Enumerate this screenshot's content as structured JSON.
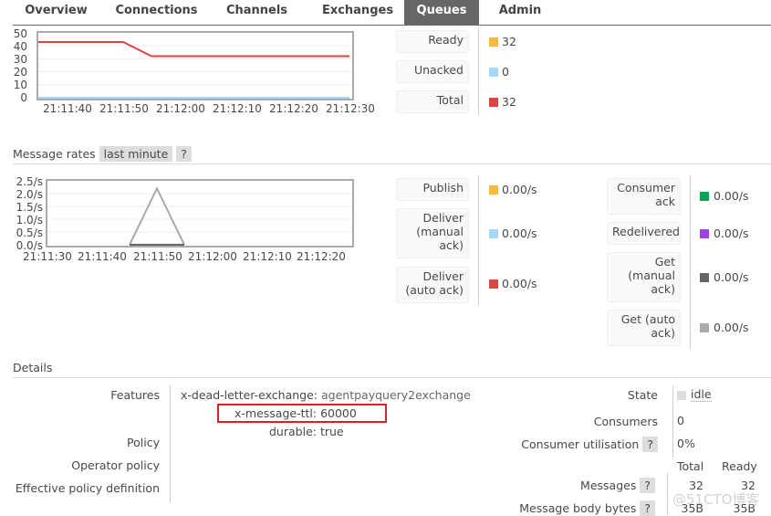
{
  "tabs": [
    {
      "label": "Overview"
    },
    {
      "label": "Connections"
    },
    {
      "label": "Channels"
    },
    {
      "label": "Exchanges"
    },
    {
      "label": "Queues",
      "active": true
    },
    {
      "label": "Admin"
    }
  ],
  "queued": {
    "legend": [
      {
        "label": "Ready",
        "value": "32",
        "color": "#f5bc41"
      },
      {
        "label": "Unacked",
        "value": "0",
        "color": "#a5d8f8"
      },
      {
        "label": "Total",
        "value": "32",
        "color": "#dd4444"
      }
    ],
    "chart_data": {
      "type": "line",
      "yticks": [
        "50",
        "40",
        "30",
        "20",
        "10",
        "0"
      ],
      "ylim": [
        0,
        50
      ],
      "xticks": [
        "21:11:40",
        "21:11:50",
        "21:12:00",
        "21:12:10",
        "21:12:20",
        "21:12:30"
      ],
      "series": [
        {
          "name": "Total",
          "color": "#dd4444",
          "points": [
            [
              "21:11:35",
              43
            ],
            [
              "21:11:50",
              43
            ],
            [
              "21:11:55",
              32
            ],
            [
              "21:12:30",
              32
            ]
          ]
        },
        {
          "name": "Unacked",
          "color": "#a5d8f8",
          "points": [
            [
              "21:11:35",
              0
            ],
            [
              "21:12:30",
              0
            ]
          ]
        }
      ]
    }
  },
  "rates": {
    "title": "Message rates",
    "range": "last minute",
    "help": "?",
    "legend_left": [
      {
        "label": "Publish",
        "value": "0.00/s",
        "color": "#f5bc41"
      },
      {
        "label": "Deliver (manual ack)",
        "value": "0.00/s",
        "color": "#a5d8f8"
      },
      {
        "label": "Deliver (auto ack)",
        "value": "0.00/s",
        "color": "#dd4444"
      }
    ],
    "legend_right": [
      {
        "label": "Consumer ack",
        "value": "0.00/s",
        "color": "#00a651"
      },
      {
        "label": "Redelivered",
        "value": "0.00/s",
        "color": "#a441e6"
      },
      {
        "label": "Get (manual ack)",
        "value": "0.00/s",
        "color": "#666666"
      },
      {
        "label": "Get (auto ack)",
        "value": "0.00/s",
        "color": "#aaaaaa"
      }
    ],
    "chart_data": {
      "type": "line",
      "yticks": [
        "2.5/s",
        "2.0/s",
        "1.5/s",
        "1.0/s",
        "0.5/s",
        "0.0/s"
      ],
      "ylim": [
        0,
        2.5
      ],
      "xticks": [
        "21:11:30",
        "21:11:40",
        "21:11:50",
        "21:12:00",
        "21:12:10",
        "21:12:20"
      ],
      "series": [
        {
          "name": "Get (auto ack)",
          "color": "#aaaaaa",
          "points": [
            [
              "21:11:45",
              0
            ],
            [
              "21:11:50",
              2.2
            ],
            [
              "21:11:55",
              0
            ]
          ]
        },
        {
          "name": "Get (manual ack)",
          "color": "#666666",
          "points": [
            [
              "21:11:45",
              0
            ],
            [
              "21:11:55",
              0
            ]
          ]
        }
      ]
    }
  },
  "details": {
    "title": "Details",
    "labels": {
      "features": "Features",
      "policy": "Policy",
      "operator_policy": "Operator policy",
      "effective": "Effective policy definition"
    },
    "features": [
      {
        "key": "x-dead-letter-exchange:",
        "value": "agentpayquery2exchange"
      },
      {
        "key": "x-message-ttl:",
        "value": "60000"
      },
      {
        "key": "durable:",
        "value": "true"
      }
    ],
    "state_label": "State",
    "state": "idle",
    "consumers_label": "Consumers",
    "consumers": "0",
    "util_label": "Consumer utilisation",
    "util": "0%",
    "col_total": "Total",
    "col_ready": "Ready",
    "messages_label": "Messages",
    "messages_total": "32",
    "messages_ready": "32",
    "bytes_label": "Message body bytes",
    "bytes_total": "35B",
    "bytes_ready": "35B",
    "help": "?"
  },
  "watermark": "@51CTO博客"
}
